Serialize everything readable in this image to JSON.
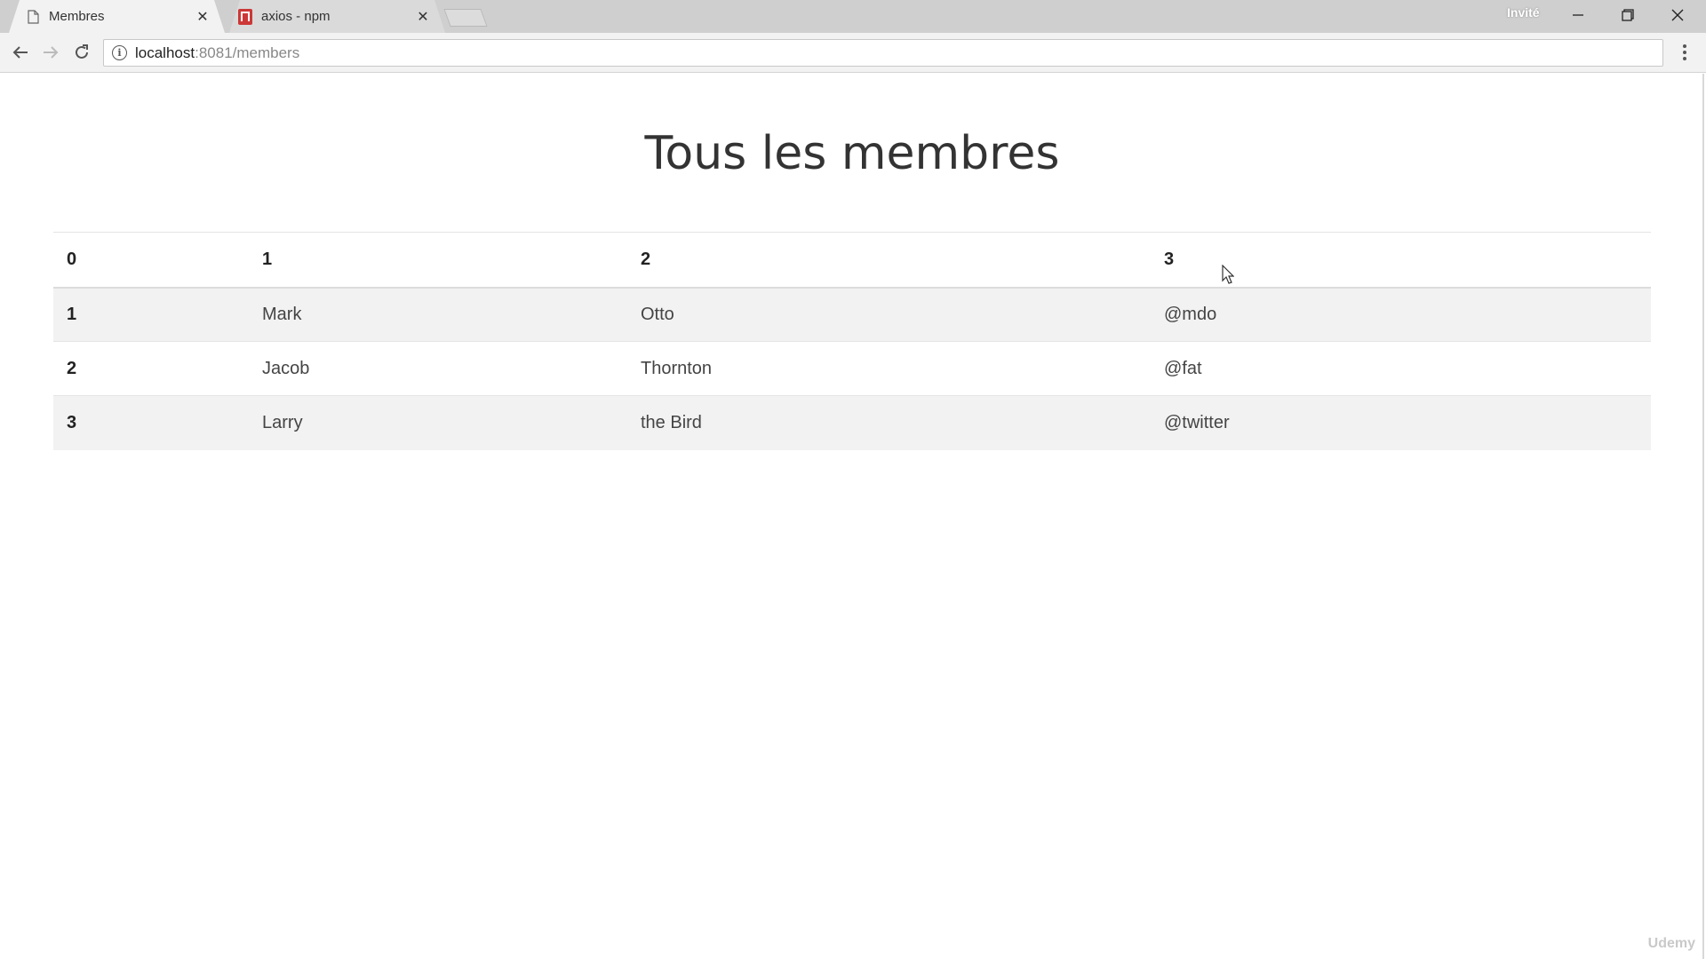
{
  "browser": {
    "tabs": [
      {
        "title": "Membres",
        "active": true,
        "icon": "page-icon"
      },
      {
        "title": "axios - npm",
        "active": false,
        "icon": "npm-icon"
      }
    ],
    "profile_label": "Invité",
    "address": {
      "host": "localhost",
      "rest": ":8081/members"
    }
  },
  "page": {
    "title": "Tous les membres",
    "table": {
      "headers": [
        "0",
        "1",
        "2",
        "3"
      ],
      "rows": [
        [
          "1",
          "Mark",
          "Otto",
          "@mdo"
        ],
        [
          "2",
          "Jacob",
          "Thornton",
          "@fat"
        ],
        [
          "3",
          "Larry",
          "the Bird",
          "@twitter"
        ]
      ]
    }
  },
  "watermark": "Udemy"
}
